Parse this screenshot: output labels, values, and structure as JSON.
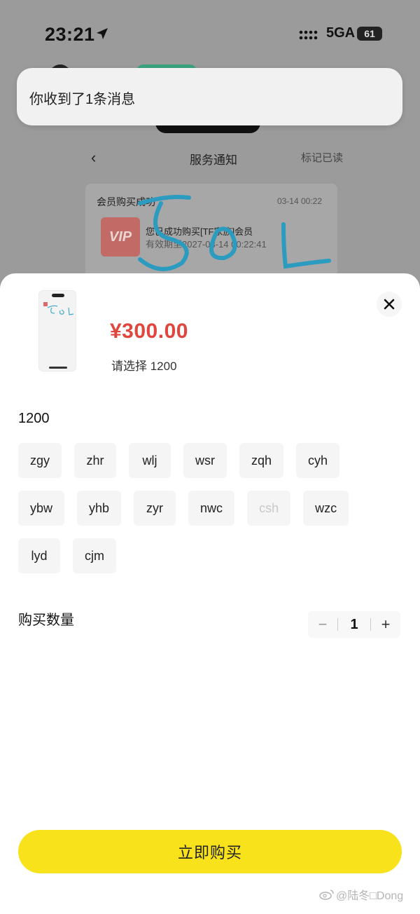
{
  "status_bar": {
    "time": "23:21",
    "network": "5GA",
    "battery": "61"
  },
  "notification": {
    "text": "你收到了1条消息"
  },
  "background_page": {
    "nav_title": "服务通知",
    "mark_read": "标记已读",
    "card_title": "会员购买成功",
    "card_date": "03-14 00:22",
    "vip_label": "VIP",
    "card_line1": "您已成功购买[TF家族]会员",
    "card_line2": "有效期至2027-03-14 00:22:41"
  },
  "product": {
    "price": "¥300.00",
    "selected_hint": "请选择 1200"
  },
  "options": {
    "group_label": "1200",
    "rows": [
      [
        {
          "label": "zgy"
        },
        {
          "label": "zhr"
        },
        {
          "label": "wlj"
        },
        {
          "label": "wsr"
        },
        {
          "label": "zqh"
        },
        {
          "label": "cyh"
        }
      ],
      [
        {
          "label": "ybw"
        },
        {
          "label": "yhb"
        },
        {
          "label": "zyr"
        },
        {
          "label": "nwc"
        },
        {
          "label": "csh",
          "disabled": true
        },
        {
          "label": "wzc"
        }
      ],
      [
        {
          "label": "lyd"
        },
        {
          "label": "cjm"
        }
      ]
    ]
  },
  "quantity": {
    "label": "购买数量",
    "minus": "−",
    "value": "1",
    "plus": "+"
  },
  "buy_button": {
    "label": "立即购买"
  },
  "watermark": {
    "text": "@陆冬□Dong"
  },
  "colors": {
    "price_red": "#e0463d",
    "buy_yellow": "#f7e21b",
    "overlay_gray": "#9b9b9b"
  }
}
